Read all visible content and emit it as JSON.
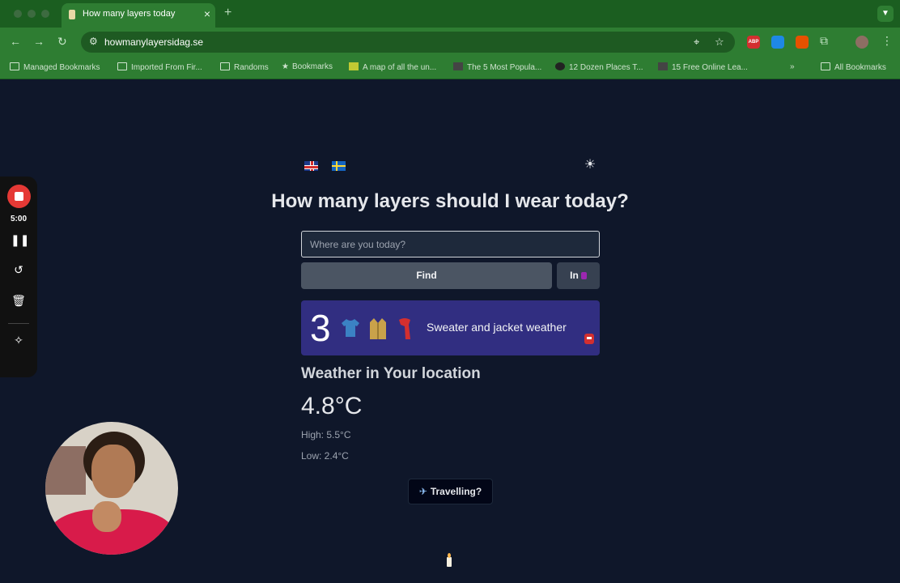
{
  "browser": {
    "tab_title": "How many layers today",
    "tab_close": "×",
    "new_tab": "+",
    "url": "howmanylayersidag.se",
    "bookmarks": [
      {
        "label": "Managed Bookmarks"
      },
      {
        "label": "Imported From Fir..."
      },
      {
        "label": "Randoms"
      },
      {
        "label": "Bookmarks"
      },
      {
        "label": "A map of all the un..."
      },
      {
        "label": "The 5 Most Popula..."
      },
      {
        "label": "12 Dozen Places T..."
      },
      {
        "label": "15 Free Online Lea..."
      },
      {
        "label": "All Bookmarks"
      }
    ],
    "bookmarks_overflow": "»",
    "extensions": [
      {
        "name": "adblock-plus-icon",
        "label": "ABP",
        "color": "#d32f2f"
      },
      {
        "name": "translate-icon",
        "label": "",
        "color": "#1e88e5"
      },
      {
        "name": "fox-extension-icon",
        "label": "",
        "color": "#e65100"
      }
    ]
  },
  "page": {
    "language_options": [
      "English",
      "Svenska"
    ],
    "headline": "How many layers should I wear today?",
    "search_placeholder": "Where are you today?",
    "find_label": "Find",
    "in_label": "In",
    "result": {
      "count": "3",
      "garments": [
        "t-shirt",
        "coat",
        "scarf"
      ],
      "summary": "Sweater and jacket weather",
      "background": "#312e81"
    },
    "weather": {
      "title": "Weather in Your location",
      "temperature": "4.8°C",
      "high": "High: 5.5°C",
      "low": "Low: 2.4°C"
    },
    "travel_label": "Travelling?"
  },
  "recorder": {
    "time": "5:00",
    "stop_color": "#e53935"
  }
}
